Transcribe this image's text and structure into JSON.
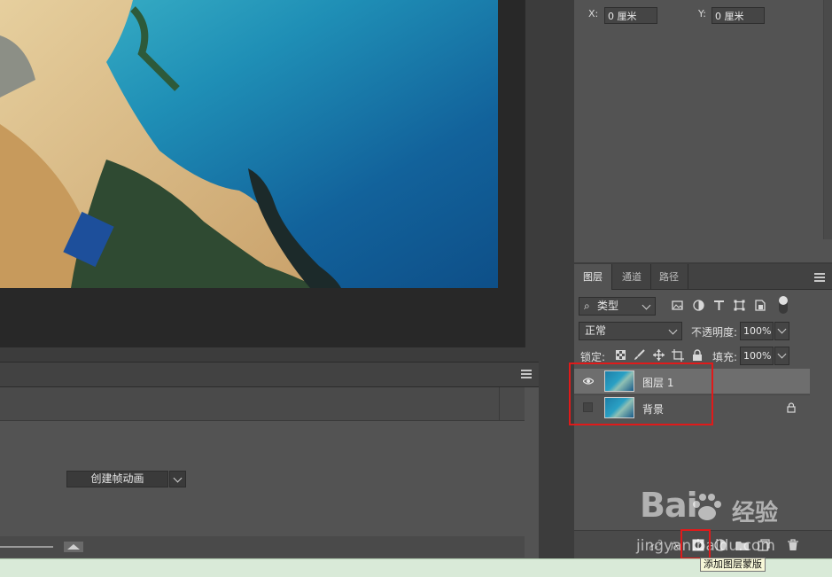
{
  "props": {
    "x_label": "X:",
    "x_value": "0 厘米",
    "y_label": "Y:",
    "y_value": "0 厘米"
  },
  "layers_panel": {
    "tabs": [
      "图层",
      "通道",
      "路径"
    ],
    "filter_kind": "类型",
    "blend_mode": "正常",
    "opacity_label": "不透明度:",
    "opacity_value": "100%",
    "lock_label": "锁定:",
    "fill_label": "填充:",
    "fill_value": "100%",
    "layers": [
      {
        "name": "图层 1",
        "visible": true,
        "selected": true,
        "locked": false
      },
      {
        "name": "背景",
        "visible": false,
        "selected": false,
        "locked": true
      }
    ]
  },
  "timeline": {
    "create_button": "创建帧动画"
  },
  "tooltip": "添加图层蒙版",
  "watermark": {
    "brand": "Bai",
    "brand2": "du",
    "product": "经验",
    "url": "jingyan.baidu.com"
  }
}
